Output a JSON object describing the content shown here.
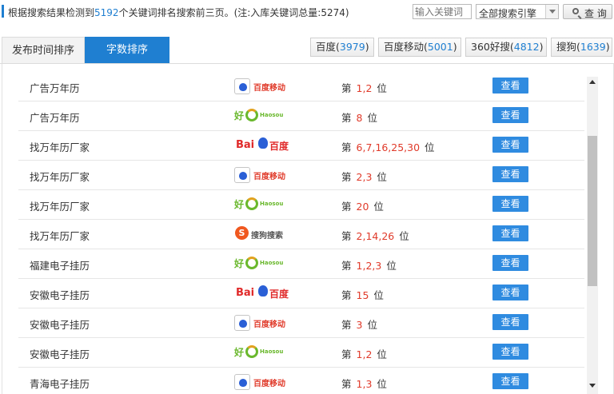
{
  "summary": {
    "prefix": "根据搜索结果检测到",
    "count": "5192",
    "suffix": "个关键词排名搜索前三页。(注:入库关键词总量:5274)"
  },
  "search": {
    "placeholder": "输入关键词",
    "engine_selected": "全部搜索引擎",
    "button_label": "查 询"
  },
  "tabs": [
    {
      "label": "发布时间排序",
      "active": false
    },
    {
      "label": "字数排序",
      "active": true
    }
  ],
  "engine_buttons": [
    {
      "label": "百度",
      "count": "3979"
    },
    {
      "label": "百度移动",
      "count": "5001"
    },
    {
      "label": "360好搜",
      "count": "4812"
    },
    {
      "label": "搜狗",
      "count": "1639"
    }
  ],
  "rank_prefix": "第",
  "rank_suffix": "位",
  "view_label": "查看",
  "logos": {
    "baidu_mobile": "百度移动",
    "haosou": "好",
    "haosou_sub": "Haosou",
    "baidu_bai": "Bai",
    "baidu_du": "百度",
    "sogou_s": "S",
    "sogou": "搜狗搜索"
  },
  "rows": [
    {
      "keyword": "广告万年历",
      "engine": "baidu-mobile",
      "positions": "1,2"
    },
    {
      "keyword": "广告万年历",
      "engine": "haosou",
      "positions": "8"
    },
    {
      "keyword": "找万年历厂家",
      "engine": "baidu",
      "positions": "6,7,16,25,30"
    },
    {
      "keyword": "找万年历厂家",
      "engine": "baidu-mobile",
      "positions": "2,3"
    },
    {
      "keyword": "找万年历厂家",
      "engine": "haosou",
      "positions": "20"
    },
    {
      "keyword": "找万年历厂家",
      "engine": "sogou",
      "positions": "2,14,26"
    },
    {
      "keyword": "福建电子挂历",
      "engine": "haosou",
      "positions": "1,2,3"
    },
    {
      "keyword": "安徽电子挂历",
      "engine": "baidu",
      "positions": "15"
    },
    {
      "keyword": "安徽电子挂历",
      "engine": "baidu-mobile",
      "positions": "3"
    },
    {
      "keyword": "安徽电子挂历",
      "engine": "haosou",
      "positions": "1,2"
    },
    {
      "keyword": "青海电子挂历",
      "engine": "baidu-mobile",
      "positions": "1,3"
    }
  ],
  "colors": {
    "accent": "#1f7fd1",
    "rank": "#e03a2a",
    "view_button": "#2f8be0"
  }
}
